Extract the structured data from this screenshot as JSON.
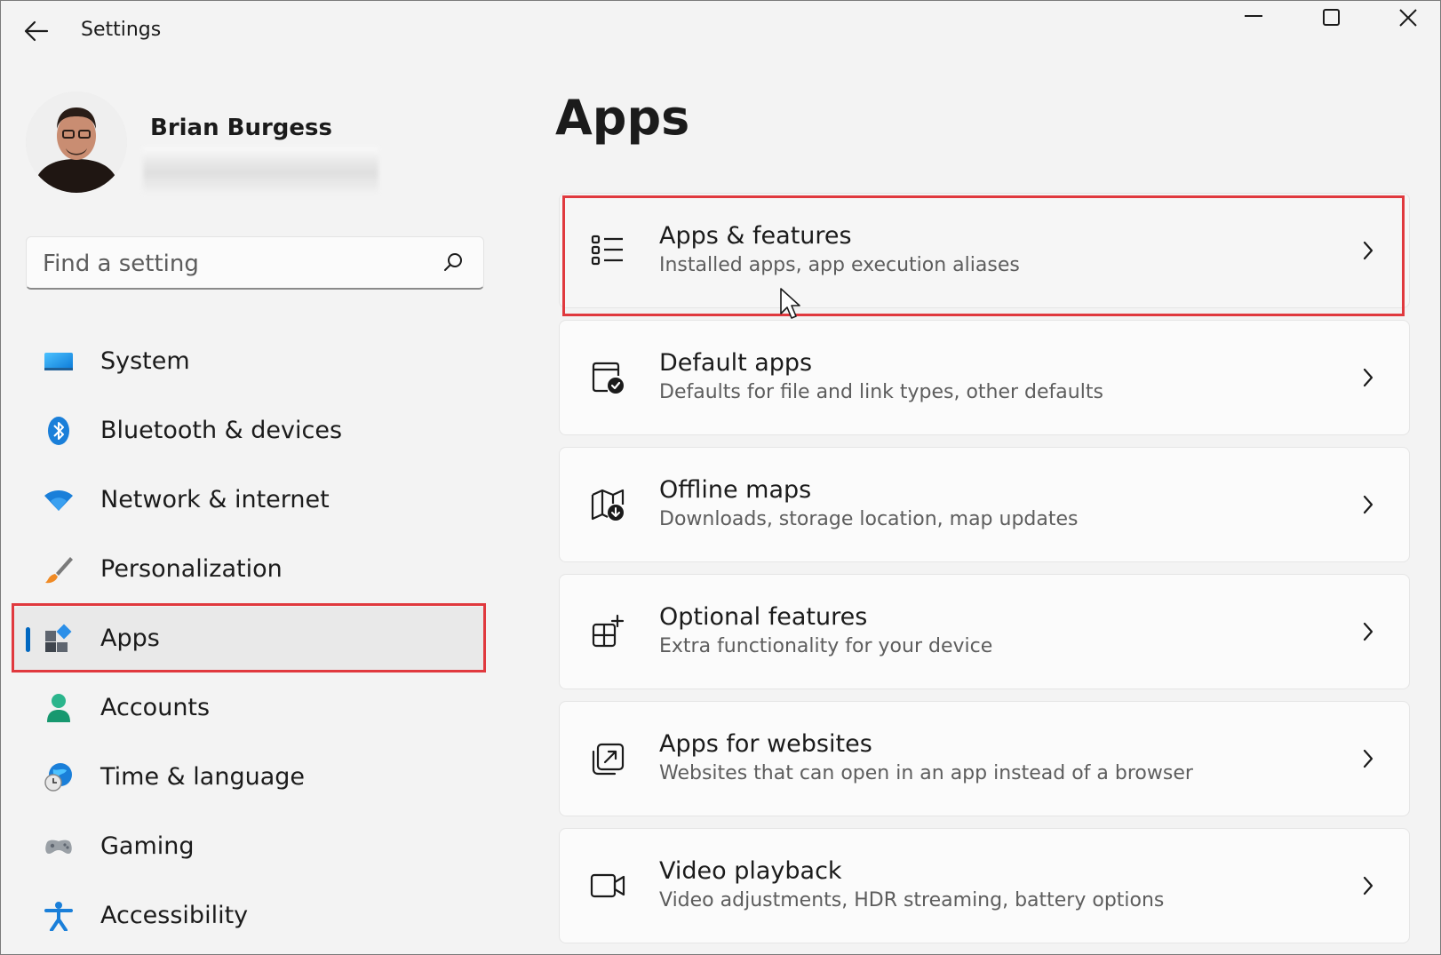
{
  "window": {
    "title": "Settings",
    "controls": {
      "minimize": "minimize-icon",
      "maximize": "maximize-icon",
      "close": "close-icon"
    }
  },
  "profile": {
    "name": "Brian Burgess"
  },
  "search": {
    "placeholder": "Find a setting"
  },
  "sidebar": {
    "items": [
      {
        "label": "System",
        "icon": "system-icon"
      },
      {
        "label": "Bluetooth & devices",
        "icon": "bluetooth-icon"
      },
      {
        "label": "Network & internet",
        "icon": "wifi-icon"
      },
      {
        "label": "Personalization",
        "icon": "brush-icon"
      },
      {
        "label": "Apps",
        "icon": "apps-icon",
        "selected": true
      },
      {
        "label": "Accounts",
        "icon": "account-icon"
      },
      {
        "label": "Time & language",
        "icon": "time-language-icon"
      },
      {
        "label": "Gaming",
        "icon": "gamepad-icon"
      },
      {
        "label": "Accessibility",
        "icon": "accessibility-icon"
      }
    ]
  },
  "main": {
    "title": "Apps",
    "cards": [
      {
        "title": "Apps & features",
        "description": "Installed apps, app execution aliases",
        "icon": "list-icon"
      },
      {
        "title": "Default apps",
        "description": "Defaults for file and link types, other defaults",
        "icon": "default-apps-icon"
      },
      {
        "title": "Offline maps",
        "description": "Downloads, storage location, map updates",
        "icon": "map-download-icon"
      },
      {
        "title": "Optional features",
        "description": "Extra functionality for your device",
        "icon": "add-feature-icon"
      },
      {
        "title": "Apps for websites",
        "description": "Websites that can open in an app instead of a browser",
        "icon": "open-external-icon"
      },
      {
        "title": "Video playback",
        "description": "Video adjustments, HDR streaming, battery options",
        "icon": "video-camera-icon"
      }
    ]
  },
  "colors": {
    "accent": "#0067c0",
    "highlight_box": "#e0393e",
    "background": "#f3f3f3"
  }
}
